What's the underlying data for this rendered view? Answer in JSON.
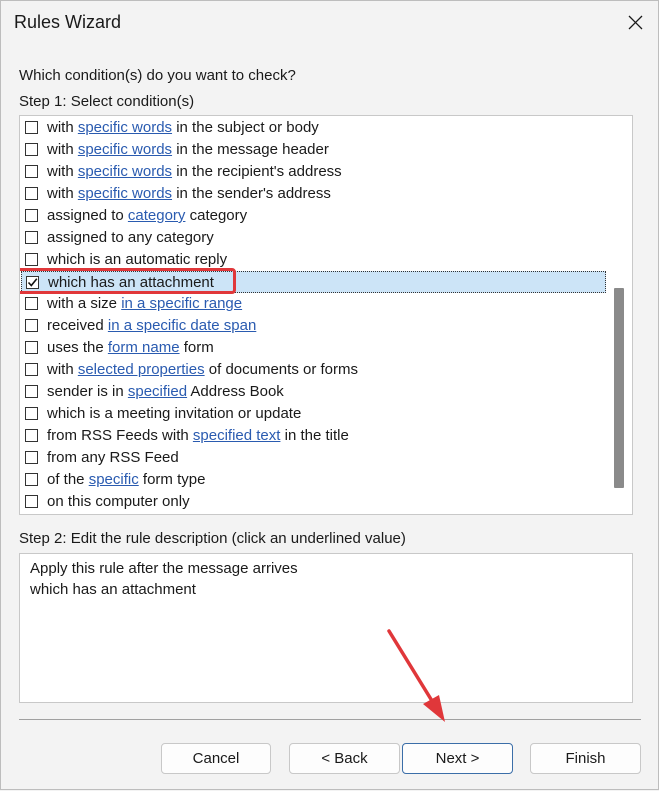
{
  "window": {
    "title": "Rules Wizard"
  },
  "prompt": "Which condition(s) do you want to check?",
  "step1_label": "Step 1: Select condition(s)",
  "conditions": [
    {
      "checked": false,
      "parts": [
        "with ",
        "[specific words]",
        " in the subject or body"
      ]
    },
    {
      "checked": false,
      "parts": [
        "with ",
        "[specific words]",
        " in the message header"
      ]
    },
    {
      "checked": false,
      "parts": [
        "with ",
        "[specific words]",
        " in the recipient's address"
      ]
    },
    {
      "checked": false,
      "parts": [
        "with ",
        "[specific words]",
        " in the sender's address"
      ]
    },
    {
      "checked": false,
      "parts": [
        "assigned to ",
        "[category]",
        " category"
      ]
    },
    {
      "checked": false,
      "parts": [
        "assigned to any category"
      ]
    },
    {
      "checked": false,
      "parts": [
        "which is an automatic reply"
      ]
    },
    {
      "checked": true,
      "selected": true,
      "parts": [
        "which has an attachment"
      ]
    },
    {
      "checked": false,
      "parts": [
        "with a size ",
        "[in a specific range]"
      ]
    },
    {
      "checked": false,
      "parts": [
        "received ",
        "[in a specific date span]"
      ]
    },
    {
      "checked": false,
      "parts": [
        "uses the ",
        "[form name]",
        " form"
      ]
    },
    {
      "checked": false,
      "parts": [
        "with ",
        "[selected properties]",
        " of documents or forms"
      ]
    },
    {
      "checked": false,
      "parts": [
        "sender is in ",
        "[specified]",
        " Address Book"
      ]
    },
    {
      "checked": false,
      "parts": [
        "which is a meeting invitation or update"
      ]
    },
    {
      "checked": false,
      "parts": [
        "from RSS Feeds with ",
        "[specified text]",
        " in the title"
      ]
    },
    {
      "checked": false,
      "parts": [
        "from any RSS Feed"
      ]
    },
    {
      "checked": false,
      "parts": [
        "of the ",
        "[specific]",
        " form type"
      ]
    },
    {
      "checked": false,
      "parts": [
        "on this computer only"
      ]
    }
  ],
  "step2_label": "Step 2: Edit the rule description (click an underlined value)",
  "description": {
    "line1": "Apply this rule after the message arrives",
    "line2": "which has an attachment"
  },
  "buttons": {
    "cancel": "Cancel",
    "back": "< Back",
    "next": "Next >",
    "finish": "Finish"
  },
  "colors": {
    "link": "#2a5bb0",
    "selection": "#cce4f7",
    "highlight": "#e0373a",
    "arrow": "#e0373a"
  }
}
